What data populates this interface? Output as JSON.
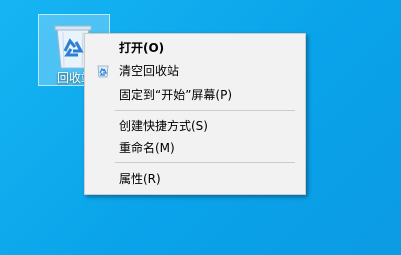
{
  "desktop": {
    "recycle_bin_label": "回收站"
  },
  "context_menu": {
    "items": [
      {
        "label": "打开(O)",
        "bold": true,
        "icon": ""
      },
      {
        "label": "清空回收站",
        "bold": false,
        "icon": "recycle-icon"
      },
      {
        "label": "固定到“开始”屏幕(P)",
        "bold": false,
        "icon": ""
      },
      {
        "label": "创建快捷方式(S)",
        "bold": false,
        "icon": ""
      },
      {
        "label": "重命名(M)",
        "bold": false,
        "icon": ""
      },
      {
        "label": "属性(R)",
        "bold": false,
        "icon": ""
      }
    ]
  },
  "colors": {
    "desktop_background": "#0aa3ea",
    "menu_background": "#f2f2f2",
    "menu_separator": "#cccccc"
  }
}
